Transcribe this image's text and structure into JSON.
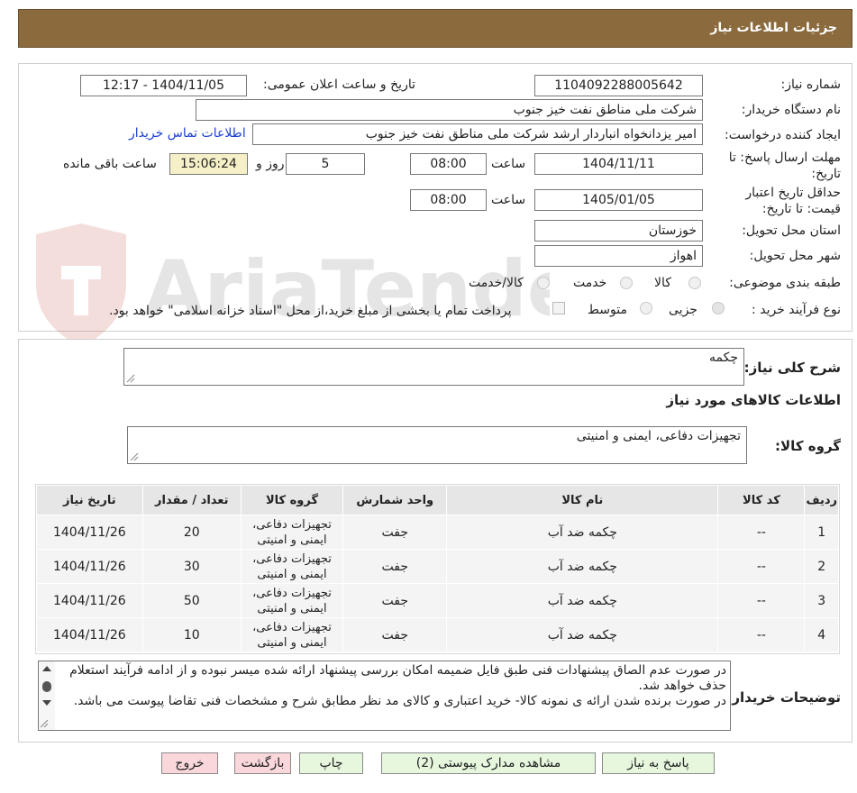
{
  "header": {
    "title": "جزئیات اطلاعات نیاز"
  },
  "watermark": {
    "text": "AriaTender.neT"
  },
  "form": {
    "need_number_label": "شماره نیاز:",
    "need_number": "1104092288005642",
    "announce_label": "تاریخ و ساعت اعلان عمومی:",
    "announce_value": "1404/11/05 - 12:17",
    "buyer_org_label": "نام دستگاه خریدار:",
    "buyer_org": "شرکت ملی مناطق نفت خیز جنوب",
    "creator_label": "ایجاد کننده درخواست:",
    "creator": "امیر یزدانخواه انباردار ارشد شرکت ملی مناطق نفت خیز جنوب",
    "contact_link": "اطلاعات تماس خریدار",
    "deadline_label": "مهلت ارسال پاسخ: تا تاریخ:",
    "deadline_date": "1404/11/11",
    "time_label": "ساعت",
    "deadline_time": "08:00",
    "days_value": "5",
    "days_label": "روز و",
    "remaining_time": "15:06:24",
    "remaining_label": "ساعت باقی مانده",
    "validity_label": "حداقل تاریخ اعتبار قیمت: تا تاریخ:",
    "validity_date": "1405/01/05",
    "validity_time": "08:00",
    "province_label": "استان محل تحویل:",
    "province": "خوزستان",
    "city_label": "شهر محل تحویل:",
    "city": "اهواز",
    "category_label": "طبقه بندی موضوعی:",
    "category_options": [
      "کالا",
      "خدمت",
      "کالا/خدمت"
    ],
    "process_label": "نوع فرآیند خرید :",
    "process_options": [
      "جزیی",
      "متوسط"
    ],
    "payment_note": "پرداخت تمام یا بخشی از مبلغ خرید،از محل \"اسناد خزانه اسلامی\" خواهد بود."
  },
  "details": {
    "general_desc_label": "شرح کلی نیاز:",
    "general_desc": "چکمه",
    "goods_info_title": "اطلاعات کالاهای مورد نیاز",
    "goods_group_label": "گروه کالا:",
    "goods_group": "تجهیزات دفاعی، ایمنی و امنیتی",
    "table": {
      "headers": [
        "ردیف",
        "کد کالا",
        "نام کالا",
        "واحد شمارش",
        "گروه کالا",
        "تعداد / مقدار",
        "تاریخ نیاز"
      ],
      "rows": [
        [
          "1",
          "--",
          "چکمه ضد آب",
          "جفت",
          "تجهیزات دفاعی، ایمنی و امنیتی",
          "20",
          "1404/11/26"
        ],
        [
          "2",
          "--",
          "چکمه ضد آب",
          "جفت",
          "تجهیزات دفاعی، ایمنی و امنیتی",
          "30",
          "1404/11/26"
        ],
        [
          "3",
          "--",
          "چکمه ضد آب",
          "جفت",
          "تجهیزات دفاعی، ایمنی و امنیتی",
          "50",
          "1404/11/26"
        ],
        [
          "4",
          "--",
          "چکمه ضد آب",
          "جفت",
          "تجهیزات دفاعی، ایمنی و امنیتی",
          "10",
          "1404/11/26"
        ]
      ]
    },
    "buyer_notes_label": "توضیحات خریدار:",
    "buyer_notes_1": "در صورت عدم الصاق پیشنهادات فنی طبق فایل ضمیمه امکان بررسی پیشنهاد ارائه شده میسر نبوده و از ادامه فرآیند استعلام حذف خواهد شد.",
    "buyer_notes_2": "در صورت برنده شدن ارائه ی نمونه کالا- خرید اعتباری و کالای مد نظر مطابق شرح و مشخصات فنی تقاضا پیوست می باشد."
  },
  "buttons": {
    "reply": "پاسخ به نیاز",
    "attachments": "مشاهده مدارک پیوستی (2)",
    "print": "چاپ",
    "back": "بازگشت",
    "exit": "خروج"
  }
}
